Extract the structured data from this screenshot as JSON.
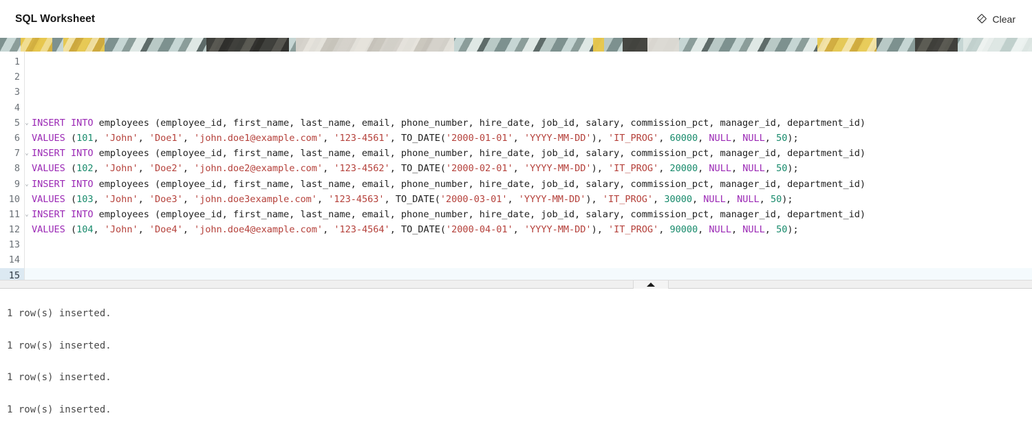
{
  "header": {
    "title": "SQL Worksheet",
    "clear_label": "Clear",
    "clear_icon": "eraser-icon"
  },
  "editor": {
    "active_line": 15,
    "total_lines": 15,
    "fold_lines": [
      5,
      7,
      9,
      11
    ],
    "line_numbers": [
      "1",
      "2",
      "3",
      "4",
      "5",
      "6",
      "7",
      "8",
      "9",
      "10",
      "11",
      "12",
      "13",
      "14",
      "15"
    ],
    "colors": {
      "keyword": "#9b29b5",
      "number": "#178a6b",
      "string": "#b5413b",
      "plain": "#222222",
      "active_line_bg": "#f4fafd",
      "active_gutter_bg": "#dce9f2"
    },
    "lines": [
      {
        "n": 1,
        "tokens": []
      },
      {
        "n": 2,
        "tokens": []
      },
      {
        "n": 3,
        "tokens": []
      },
      {
        "n": 4,
        "tokens": []
      },
      {
        "n": 5,
        "tokens": [
          {
            "t": "INSERT INTO",
            "c": "kw"
          },
          {
            "t": " employees (employee_id, first_name, last_name, email, phone_number, hire_date, job_id, salary, commission_pct, manager_id, department_id)",
            "c": "id"
          }
        ]
      },
      {
        "n": 6,
        "tokens": [
          {
            "t": "VALUES",
            "c": "kw"
          },
          {
            "t": " (",
            "c": "id"
          },
          {
            "t": "101",
            "c": "num"
          },
          {
            "t": ", ",
            "c": "id"
          },
          {
            "t": "'John'",
            "c": "str"
          },
          {
            "t": ", ",
            "c": "id"
          },
          {
            "t": "'Doe1'",
            "c": "str"
          },
          {
            "t": ", ",
            "c": "id"
          },
          {
            "t": "'john.doe1@example.com'",
            "c": "str"
          },
          {
            "t": ", ",
            "c": "id"
          },
          {
            "t": "'123-4561'",
            "c": "str"
          },
          {
            "t": ", TO_DATE(",
            "c": "id"
          },
          {
            "t": "'2000-01-01'",
            "c": "str"
          },
          {
            "t": ", ",
            "c": "id"
          },
          {
            "t": "'YYYY-MM-DD'",
            "c": "str"
          },
          {
            "t": "), ",
            "c": "id"
          },
          {
            "t": "'IT_PROG'",
            "c": "str"
          },
          {
            "t": ", ",
            "c": "id"
          },
          {
            "t": "60000",
            "c": "num"
          },
          {
            "t": ", ",
            "c": "id"
          },
          {
            "t": "NULL",
            "c": "kw"
          },
          {
            "t": ", ",
            "c": "id"
          },
          {
            "t": "NULL",
            "c": "kw"
          },
          {
            "t": ", ",
            "c": "id"
          },
          {
            "t": "50",
            "c": "num"
          },
          {
            "t": ");",
            "c": "id"
          }
        ]
      },
      {
        "n": 7,
        "tokens": [
          {
            "t": "INSERT INTO",
            "c": "kw"
          },
          {
            "t": " employees (employee_id, first_name, last_name, email, phone_number, hire_date, job_id, salary, commission_pct, manager_id, department_id)",
            "c": "id"
          }
        ]
      },
      {
        "n": 8,
        "tokens": [
          {
            "t": "VALUES",
            "c": "kw"
          },
          {
            "t": " (",
            "c": "id"
          },
          {
            "t": "102",
            "c": "num"
          },
          {
            "t": ", ",
            "c": "id"
          },
          {
            "t": "'John'",
            "c": "str"
          },
          {
            "t": ", ",
            "c": "id"
          },
          {
            "t": "'Doe2'",
            "c": "str"
          },
          {
            "t": ", ",
            "c": "id"
          },
          {
            "t": "'john.doe2@example.com'",
            "c": "str"
          },
          {
            "t": ", ",
            "c": "id"
          },
          {
            "t": "'123-4562'",
            "c": "str"
          },
          {
            "t": ", TO_DATE(",
            "c": "id"
          },
          {
            "t": "'2000-02-01'",
            "c": "str"
          },
          {
            "t": ", ",
            "c": "id"
          },
          {
            "t": "'YYYY-MM-DD'",
            "c": "str"
          },
          {
            "t": "), ",
            "c": "id"
          },
          {
            "t": "'IT_PROG'",
            "c": "str"
          },
          {
            "t": ", ",
            "c": "id"
          },
          {
            "t": "20000",
            "c": "num"
          },
          {
            "t": ", ",
            "c": "id"
          },
          {
            "t": "NULL",
            "c": "kw"
          },
          {
            "t": ", ",
            "c": "id"
          },
          {
            "t": "NULL",
            "c": "kw"
          },
          {
            "t": ", ",
            "c": "id"
          },
          {
            "t": "50",
            "c": "num"
          },
          {
            "t": ");",
            "c": "id"
          }
        ]
      },
      {
        "n": 9,
        "tokens": [
          {
            "t": "INSERT INTO",
            "c": "kw"
          },
          {
            "t": " employees (employee_id, first_name, last_name, email, phone_number, hire_date, job_id, salary, commission_pct, manager_id, department_id)",
            "c": "id"
          }
        ]
      },
      {
        "n": 10,
        "tokens": [
          {
            "t": "VALUES",
            "c": "kw"
          },
          {
            "t": " (",
            "c": "id"
          },
          {
            "t": "103",
            "c": "num"
          },
          {
            "t": ", ",
            "c": "id"
          },
          {
            "t": "'John'",
            "c": "str"
          },
          {
            "t": ", ",
            "c": "id"
          },
          {
            "t": "'Doe3'",
            "c": "str"
          },
          {
            "t": ", ",
            "c": "id"
          },
          {
            "t": "'john.doe3example.com'",
            "c": "str"
          },
          {
            "t": ", ",
            "c": "id"
          },
          {
            "t": "'123-4563'",
            "c": "str"
          },
          {
            "t": ", TO_DATE(",
            "c": "id"
          },
          {
            "t": "'2000-03-01'",
            "c": "str"
          },
          {
            "t": ", ",
            "c": "id"
          },
          {
            "t": "'YYYY-MM-DD'",
            "c": "str"
          },
          {
            "t": "), ",
            "c": "id"
          },
          {
            "t": "'IT_PROG'",
            "c": "str"
          },
          {
            "t": ", ",
            "c": "id"
          },
          {
            "t": "30000",
            "c": "num"
          },
          {
            "t": ", ",
            "c": "id"
          },
          {
            "t": "NULL",
            "c": "kw"
          },
          {
            "t": ", ",
            "c": "id"
          },
          {
            "t": "NULL",
            "c": "kw"
          },
          {
            "t": ", ",
            "c": "id"
          },
          {
            "t": "50",
            "c": "num"
          },
          {
            "t": ");",
            "c": "id"
          }
        ]
      },
      {
        "n": 11,
        "tokens": [
          {
            "t": "INSERT INTO",
            "c": "kw"
          },
          {
            "t": " employees (employee_id, first_name, last_name, email, phone_number, hire_date, job_id, salary, commission_pct, manager_id, department_id)",
            "c": "id"
          }
        ]
      },
      {
        "n": 12,
        "tokens": [
          {
            "t": "VALUES",
            "c": "kw"
          },
          {
            "t": " (",
            "c": "id"
          },
          {
            "t": "104",
            "c": "num"
          },
          {
            "t": ", ",
            "c": "id"
          },
          {
            "t": "'John'",
            "c": "str"
          },
          {
            "t": ", ",
            "c": "id"
          },
          {
            "t": "'Doe4'",
            "c": "str"
          },
          {
            "t": ", ",
            "c": "id"
          },
          {
            "t": "'john.doe4@example.com'",
            "c": "str"
          },
          {
            "t": ", ",
            "c": "id"
          },
          {
            "t": "'123-4564'",
            "c": "str"
          },
          {
            "t": ", TO_DATE(",
            "c": "id"
          },
          {
            "t": "'2000-04-01'",
            "c": "str"
          },
          {
            "t": ", ",
            "c": "id"
          },
          {
            "t": "'YYYY-MM-DD'",
            "c": "str"
          },
          {
            "t": "), ",
            "c": "id"
          },
          {
            "t": "'IT_PROG'",
            "c": "str"
          },
          {
            "t": ", ",
            "c": "id"
          },
          {
            "t": "90000",
            "c": "num"
          },
          {
            "t": ", ",
            "c": "id"
          },
          {
            "t": "NULL",
            "c": "kw"
          },
          {
            "t": ", ",
            "c": "id"
          },
          {
            "t": "NULL",
            "c": "kw"
          },
          {
            "t": ", ",
            "c": "id"
          },
          {
            "t": "50",
            "c": "num"
          },
          {
            "t": ");",
            "c": "id"
          }
        ]
      },
      {
        "n": 13,
        "tokens": []
      },
      {
        "n": 14,
        "tokens": []
      },
      {
        "n": 15,
        "tokens": []
      }
    ]
  },
  "splitter": {
    "handle_icon": "collapse-up-triangle-icon"
  },
  "results": {
    "messages": [
      "1 row(s) inserted.",
      "1 row(s) inserted.",
      "1 row(s) inserted.",
      "1 row(s) inserted."
    ]
  }
}
